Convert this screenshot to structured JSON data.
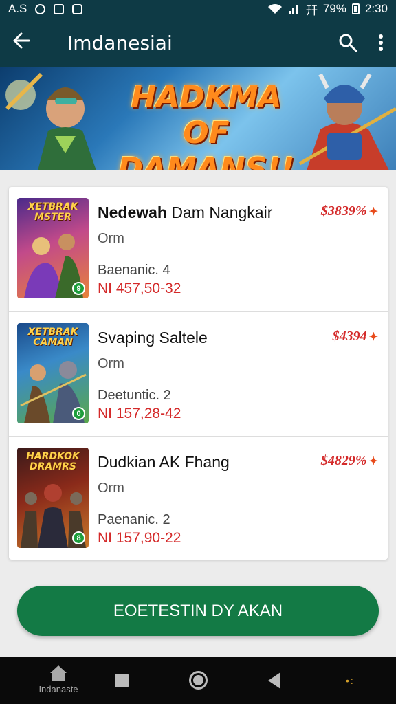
{
  "status_bar": {
    "left_text": "A.S",
    "network": "幵",
    "battery_percent": "79%",
    "time": "2:30"
  },
  "app_bar": {
    "back_icon": "arrow-left-icon",
    "title": "Imdanesiai",
    "search_icon": "search-icon",
    "menu_icon": "more-vert-icon"
  },
  "banner": {
    "title_line1": "HADKMA",
    "title_line2": "OF DAMANS!!"
  },
  "items": [
    {
      "thumb_title_line1": "XETBRAK",
      "thumb_title_line2": "MSTER",
      "badge": "9",
      "title_bold": "Nedewah",
      "title_rest": " Dam Nangkair",
      "price": "$3839%",
      "sub": "Orm",
      "meta": "Baenanic. 4",
      "code": "NI  457,50-32"
    },
    {
      "thumb_title_line1": "XETBRAK",
      "thumb_title_line2": "CAMAN",
      "badge": "0",
      "title_bold": "",
      "title_rest": "Svaping Saltele",
      "price": "$4394",
      "sub": "Orm",
      "meta": "Deetuntic. 2",
      "code": "NI  157,28-42"
    },
    {
      "thumb_title_line1": "HARDKOK",
      "thumb_title_line2": "DRAMRS",
      "badge": "8",
      "title_bold": "",
      "title_rest": "Dudkian AK Fhang",
      "price": "$4829%",
      "sub": "Orm",
      "meta": "Paenanic. 2",
      "code": "NI  157,90-22"
    }
  ],
  "cta": {
    "label": "EOETESTIN DY AKAN"
  },
  "nav": {
    "home_label": "Indanaste"
  },
  "colors": {
    "app_bar": "#0e3a45",
    "price": "#d42a2a",
    "cta": "#137a45"
  }
}
